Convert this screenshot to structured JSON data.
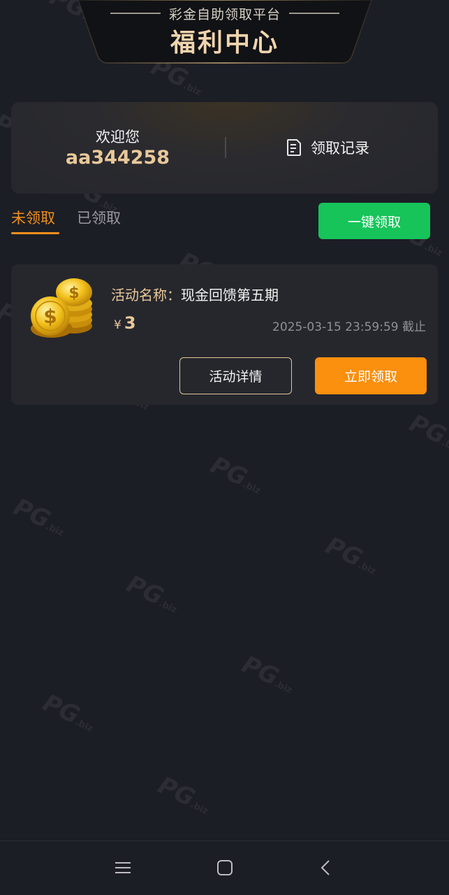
{
  "header": {
    "subtitle": "彩金自助领取平台",
    "title": "福利中心"
  },
  "welcome": {
    "label": "欢迎您",
    "username": "aa344258",
    "record_label": "领取记录",
    "record_icon": "document-icon"
  },
  "tabs": [
    {
      "label": "未领取",
      "active": true
    },
    {
      "label": "已领取",
      "active": false
    }
  ],
  "one_click_label": "一键领取",
  "activity": {
    "name_label": "活动名称：",
    "name_value": "现金回馈第五期",
    "currency": "¥",
    "amount": "3",
    "deadline": "2025-03-15 23:59:59 截止",
    "detail_label": "活动详情",
    "claim_label": "立即领取",
    "icon": "coins-icon"
  },
  "watermark": {
    "text": "PG",
    "suffix": ".biz"
  },
  "navbar": {
    "items": [
      "menu-icon",
      "home-icon",
      "back-icon"
    ]
  },
  "colors": {
    "background": "#1c1e25",
    "card": "#26272d",
    "accent_orange": "#f08f1c",
    "claim_orange": "#fb8f0e",
    "green": "#16c45a",
    "gold_text": "#e9c89a"
  }
}
